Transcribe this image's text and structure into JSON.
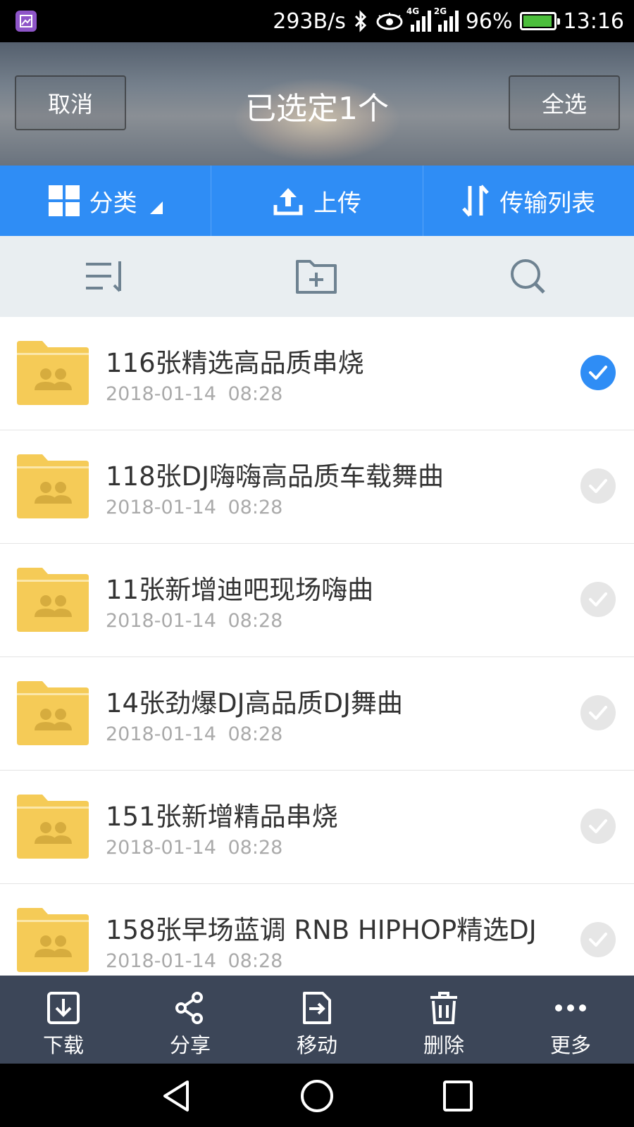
{
  "status_bar": {
    "speed": "293B/s",
    "net1": "4G",
    "net2": "2G",
    "battery": "96%",
    "battery_level": 0.96,
    "time": "13:16"
  },
  "header": {
    "cancel_label": "取消",
    "title": "已选定1个",
    "select_all_label": "全选"
  },
  "tabs": [
    {
      "label": "分类",
      "icon": "grid-icon"
    },
    {
      "label": "上传",
      "icon": "upload-icon"
    },
    {
      "label": "传输列表",
      "icon": "transfer-icon"
    }
  ],
  "toolbar": {
    "sort_icon": "sort-icon",
    "new_folder_icon": "new-folder-icon",
    "search_icon": "search-icon"
  },
  "files": [
    {
      "name": "116张精选高品质串烧",
      "date": "2018-01-14 08:28",
      "selected": true
    },
    {
      "name": "118张DJ嗨嗨高品质车载舞曲",
      "date": "2018-01-14 08:28",
      "selected": false
    },
    {
      "name": "11张新增迪吧现场嗨曲",
      "date": "2018-01-14 08:28",
      "selected": false
    },
    {
      "name": "14张劲爆DJ高品质DJ舞曲",
      "date": "2018-01-14 08:28",
      "selected": false
    },
    {
      "name": "151张新增精品串烧",
      "date": "2018-01-14 08:28",
      "selected": false
    },
    {
      "name": "158张早场蓝调 RNB HIPHOP精选DJ",
      "date": "2018-01-14 08:28",
      "selected": false
    }
  ],
  "actions": [
    {
      "label": "下载",
      "icon": "download-icon"
    },
    {
      "label": "分享",
      "icon": "share-icon"
    },
    {
      "label": "移动",
      "icon": "move-icon"
    },
    {
      "label": "删除",
      "icon": "delete-icon"
    },
    {
      "label": "更多",
      "icon": "more-icon"
    }
  ],
  "colors": {
    "accent": "#2f8df5",
    "folder": "#f5cb57",
    "action_bar": "#3c4658"
  }
}
